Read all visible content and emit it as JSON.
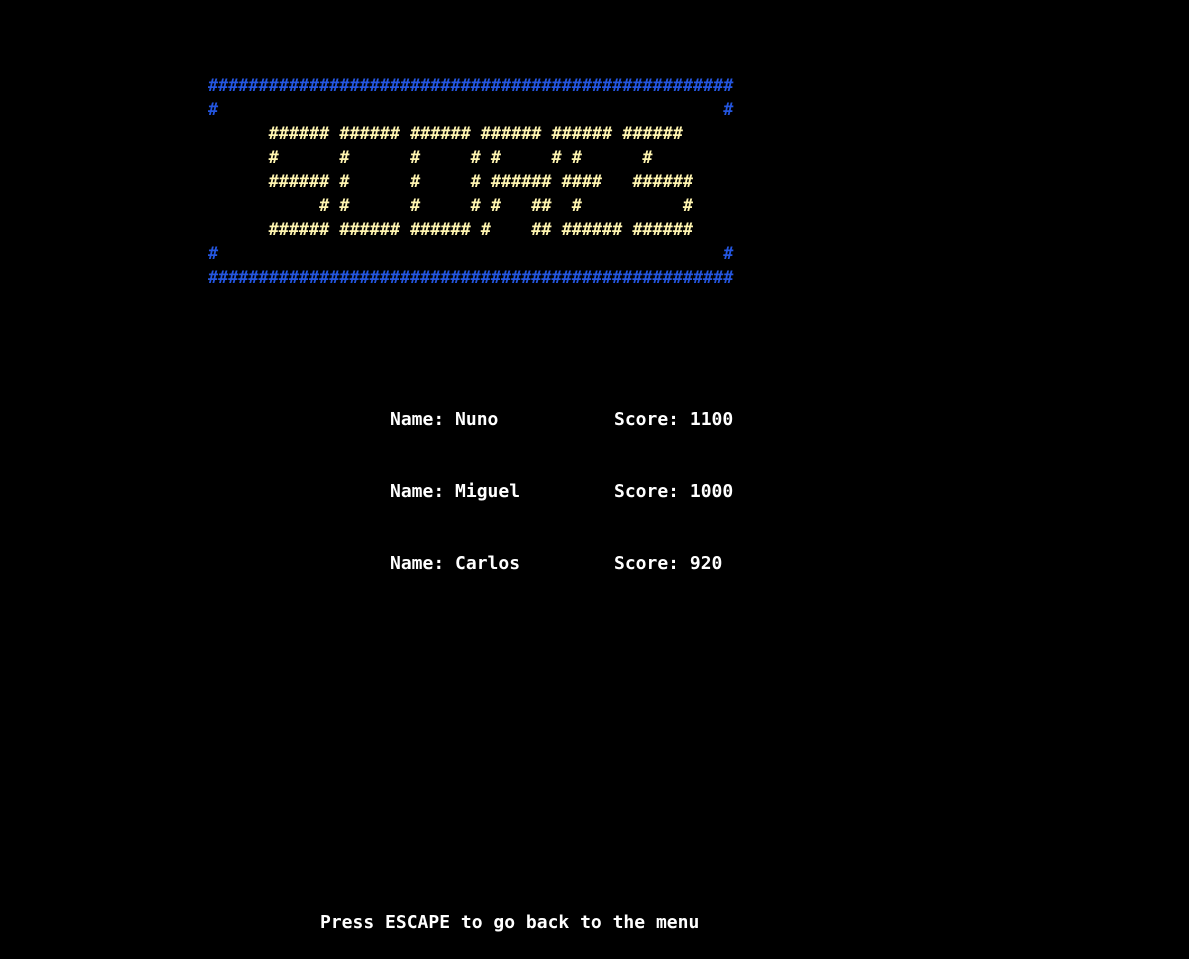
{
  "banner": {
    "lines": [
      {
        "role": "border",
        "text": "####################################################"
      },
      {
        "role": "border",
        "text": "#                                                  #"
      },
      {
        "role": "letters",
        "text": "      ###### ###### ###### ###### ###### ######"
      },
      {
        "role": "letters",
        "text": "      #      #      #     # #     # #      #"
      },
      {
        "role": "letters",
        "text": "      ###### #      #     # ###### ####   ######"
      },
      {
        "role": "letters",
        "text": "           # #      #     # #   ##  #          #"
      },
      {
        "role": "letters",
        "text": "      ###### ###### ###### #    ## ###### ######"
      },
      {
        "role": "border",
        "text": "#                                                  #"
      },
      {
        "role": "border",
        "text": "####################################################"
      }
    ],
    "border_color": "#2456e0",
    "letter_color": "#fff5b0"
  },
  "scores": {
    "name_label": "Name:",
    "score_label": "Score:",
    "entries": [
      {
        "name": "Nuno",
        "score": "1100"
      },
      {
        "name": "Miguel",
        "score": "1000"
      },
      {
        "name": "Carlos",
        "score": "920"
      }
    ]
  },
  "footer": {
    "hint": "Press ESCAPE to go back to the menu"
  },
  "colors": {
    "background": "#000000",
    "text": "#ffffff"
  }
}
